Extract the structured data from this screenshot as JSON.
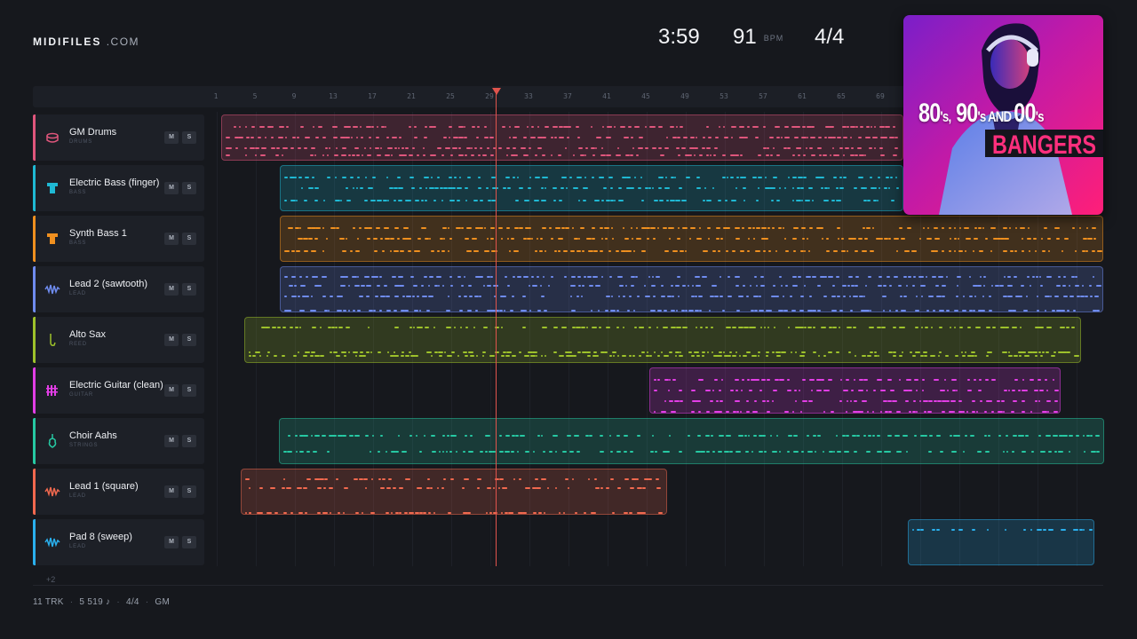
{
  "brand": {
    "name": "MIDIFILES",
    "tld": ".COM"
  },
  "song": {
    "duration": "3:59",
    "tempo": "91",
    "tempo_unit": "BPM",
    "time_signature": "4/4"
  },
  "ruler": {
    "bars": [
      "1",
      "5",
      "9",
      "13",
      "17",
      "21",
      "25",
      "29",
      "33",
      "37",
      "41",
      "45",
      "49",
      "53",
      "57",
      "61",
      "65",
      "69"
    ]
  },
  "tracks": [
    {
      "name": "GM Drums",
      "category": "DRUMS",
      "color": "#e0567c",
      "icon": "drum-icon",
      "mute": "M",
      "solo": "S"
    },
    {
      "name": "Electric Bass (finger)",
      "category": "BASS",
      "color": "#1fb9d4",
      "icon": "bass-icon",
      "mute": "M",
      "solo": "S"
    },
    {
      "name": "Synth Bass 1",
      "category": "BASS",
      "color": "#f0901f",
      "icon": "bass-icon",
      "mute": "M",
      "solo": "S"
    },
    {
      "name": "Lead 2 (sawtooth)",
      "category": "LEAD",
      "color": "#6f8cf0",
      "icon": "wave-icon",
      "mute": "M",
      "solo": "S"
    },
    {
      "name": "Alto Sax",
      "category": "REED",
      "color": "#9ec22b",
      "icon": "sax-icon",
      "mute": "M",
      "solo": "S"
    },
    {
      "name": "Electric Guitar (clean)",
      "category": "GUITAR",
      "color": "#e23ee6",
      "icon": "guitar-icon",
      "mute": "M",
      "solo": "S"
    },
    {
      "name": "Choir Aahs",
      "category": "STRINGS",
      "color": "#26c9a3",
      "icon": "violin-icon",
      "mute": "M",
      "solo": "S"
    },
    {
      "name": "Lead 1 (square)",
      "category": "LEAD",
      "color": "#f2694f",
      "icon": "wave-icon",
      "mute": "M",
      "solo": "S"
    },
    {
      "name": "Pad 8 (sweep)",
      "category": "LEAD",
      "color": "#2ab0ee",
      "icon": "wave-icon",
      "mute": "M",
      "solo": "S"
    }
  ],
  "more_tracks": "+2",
  "footer": {
    "tracks": "11 TRK",
    "notes": "5 519 ♪",
    "signature": "4/4",
    "standard": "GM",
    "separator": "·"
  },
  "cover": {
    "line1_a": "80",
    "line1_a_s": "'s,",
    "line1_b": " 90",
    "line1_b_s": "'s",
    "line1_and": " AND ",
    "line1_c": "00",
    "line1_c_s": "'s",
    "line2": "BANGERS"
  },
  "playhead_bar": "29"
}
